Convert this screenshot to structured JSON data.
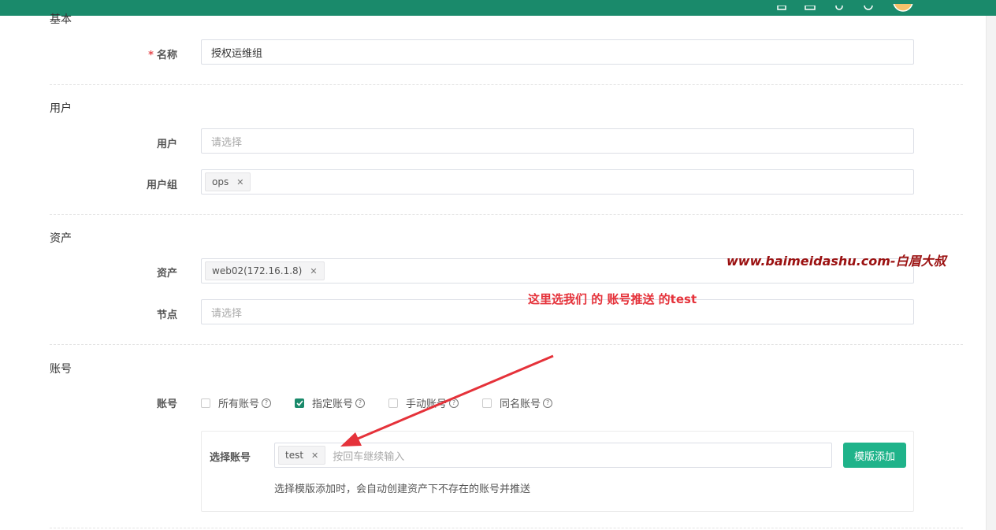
{
  "sections": {
    "basic": "基本",
    "user": "用户",
    "asset": "资产",
    "account": "账号"
  },
  "fields": {
    "name_label": "名称",
    "name_value": "授权运维组",
    "users_label": "用户",
    "users_placeholder": "请选择",
    "user_groups_label": "用户组",
    "user_group_tag": "ops",
    "assets_label": "资产",
    "asset_tag": "web02(172.16.1.8)",
    "nodes_label": "节点",
    "nodes_placeholder": "请选择",
    "accounts_label": "账号"
  },
  "account_options": [
    {
      "label": "所有账号",
      "checked": false
    },
    {
      "label": "指定账号",
      "checked": true
    },
    {
      "label": "手动账号",
      "checked": false
    },
    {
      "label": "同名账号",
      "checked": false
    }
  ],
  "select_account": {
    "label": "选择账号",
    "tag": "test",
    "placeholder": "按回车继续输入",
    "template_button": "模版添加",
    "hint": "选择模版添加时，会自动创建资产下不存在的账号并推送"
  },
  "overlay": {
    "watermark": "www.baimeidashu.com-白眉大叔",
    "annotation": "这里选我们 的 账号推送 的test"
  },
  "colors": {
    "accent": "#1a8a6b",
    "button": "#1fb38a",
    "annotation": "#e5323a"
  }
}
